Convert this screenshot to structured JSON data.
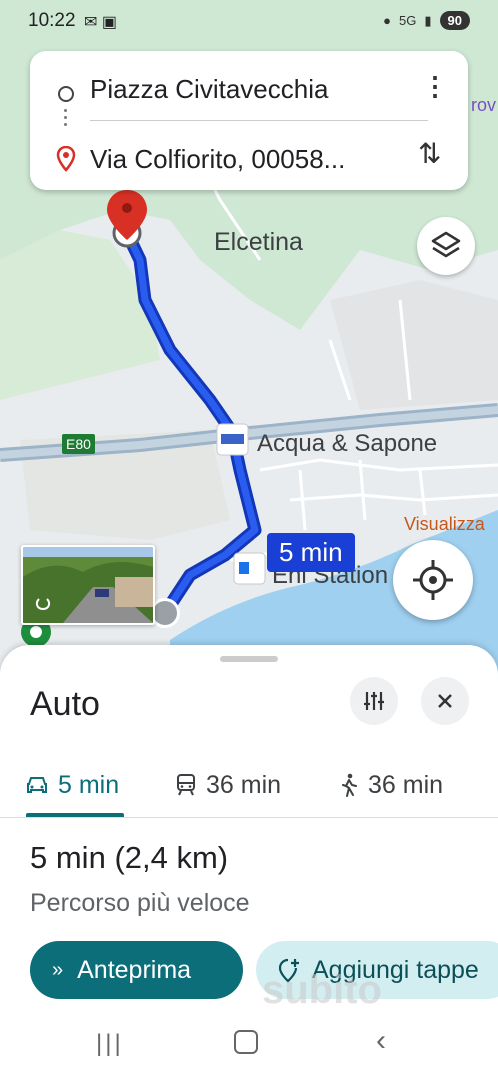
{
  "status_bar": {
    "time": "10:22",
    "network": "5G",
    "battery": "90"
  },
  "route_card": {
    "origin": "Piazza Civitavecchia",
    "destination": "Via Colfiorito, 00058..."
  },
  "map": {
    "labels": {
      "town": "Elcetina",
      "highway": "E80",
      "store": "Acqua & Sapone",
      "station": "Eni Station",
      "visualizza": "Visualizza",
      "edge": "rov"
    },
    "route_time": "5 min"
  },
  "sheet": {
    "title": "Auto",
    "tabs": [
      {
        "mode": "car",
        "label": "5 min",
        "active": true
      },
      {
        "mode": "transit",
        "label": "36 min",
        "active": false
      },
      {
        "mode": "walk",
        "label": "36 min",
        "active": false
      }
    ],
    "duration": "5 min",
    "distance": "(2,4 km)",
    "route_desc": "Percorso più veloce",
    "primary_button": "Anteprima",
    "secondary_button": "Aggiungi tappe"
  },
  "watermark": "subito",
  "colors": {
    "route": "#1a3fd4",
    "accent": "#0b6e79",
    "pin": "#d93025"
  }
}
